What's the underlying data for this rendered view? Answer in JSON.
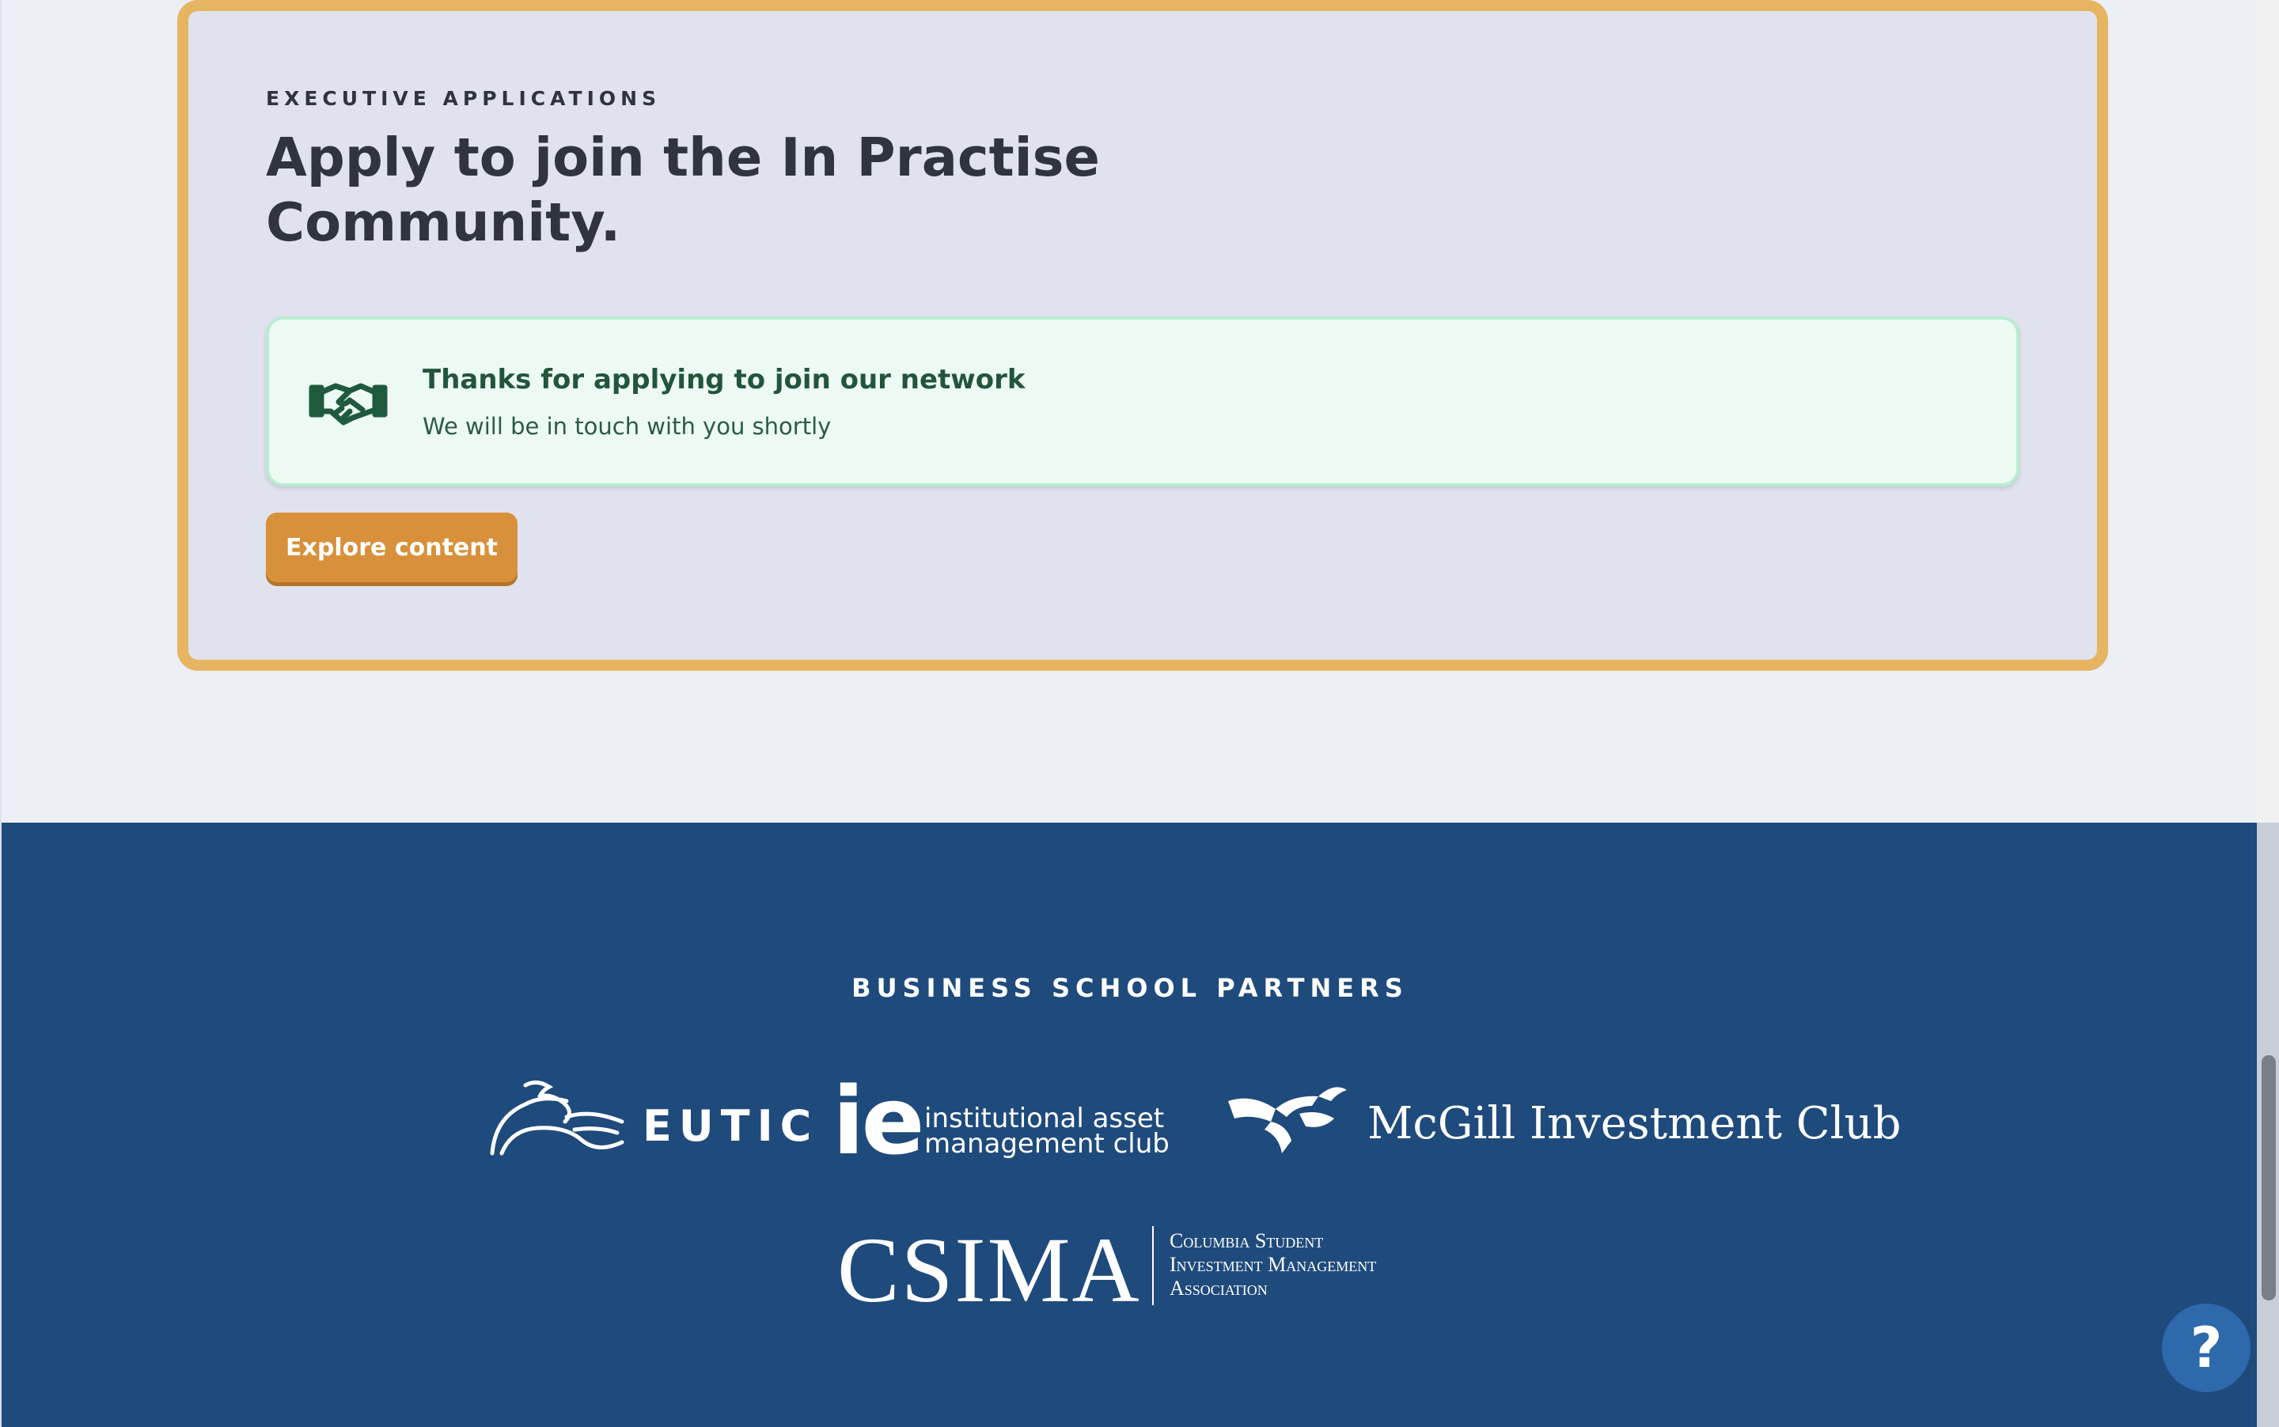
{
  "application": {
    "eyebrow": "EXECUTIVE APPLICATIONS",
    "title": "Apply to join the In Practise Community.",
    "success": {
      "title": "Thanks for applying to join our network",
      "message": "We will be in touch with you shortly",
      "icon": "handshake-icon"
    },
    "explore_button": "Explore content"
  },
  "partners": {
    "heading": "BUSINESS SCHOOL PARTNERS",
    "logos": {
      "eutic": "EUTIC",
      "ie_mark": "ie",
      "ie_line1": "institutional asset",
      "ie_line2": "management club",
      "mcgill": "McGill Investment Club",
      "csima": "CSIMA",
      "csima_line1": "Columbia Student",
      "csima_line2": "Investment Management",
      "csima_line3": "Association"
    }
  },
  "help": {
    "label": "?"
  },
  "colors": {
    "card_border": "#e7b462",
    "button": "#d8913a",
    "success_bg": "#ecfaf3",
    "footer": "#1f4a7c",
    "help": "#2d69ab"
  }
}
